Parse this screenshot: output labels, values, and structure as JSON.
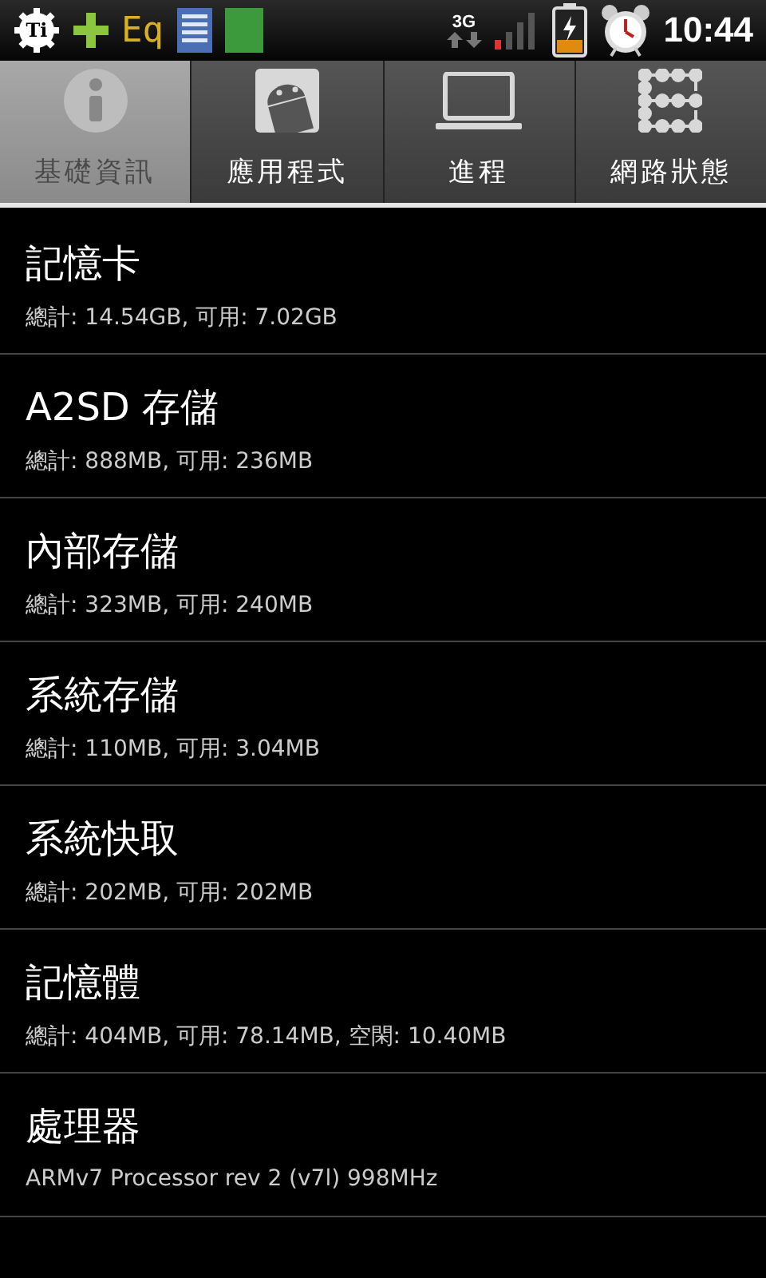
{
  "status_bar": {
    "app_logo": "Ti",
    "eq": "Eq",
    "network": "3G",
    "time": "10:44"
  },
  "tabs": [
    {
      "label": "基礎資訊",
      "kind": "info",
      "selected": true
    },
    {
      "label": "應用程式",
      "kind": "android",
      "selected": false
    },
    {
      "label": "進程",
      "kind": "laptop",
      "selected": false
    },
    {
      "label": "網路狀態",
      "kind": "grid",
      "selected": false
    }
  ],
  "items": [
    {
      "title": "記憶卡",
      "detail": "總計: 14.54GB, 可用: 7.02GB"
    },
    {
      "title": "A2SD 存儲",
      "detail": "總計: 888MB, 可用: 236MB"
    },
    {
      "title": "內部存儲",
      "detail": "總計: 323MB, 可用: 240MB"
    },
    {
      "title": "系統存儲",
      "detail": "總計: 110MB, 可用: 3.04MB"
    },
    {
      "title": "系統快取",
      "detail": "總計: 202MB, 可用: 202MB"
    },
    {
      "title": "記憶體",
      "detail": "總計: 404MB, 可用: 78.14MB, 空閑: 10.40MB"
    },
    {
      "title": "處理器",
      "detail": "ARMv7 Processor rev 2 (v7l)  998MHz"
    }
  ]
}
